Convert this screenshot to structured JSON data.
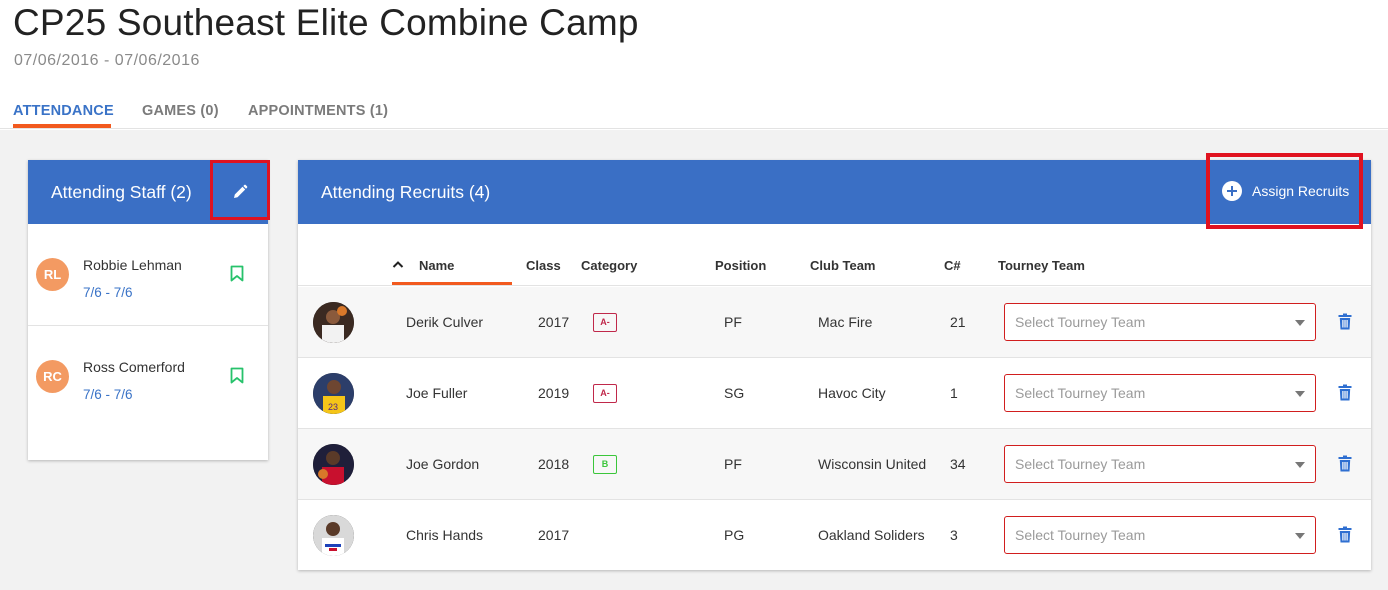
{
  "header": {
    "title": "CP25 Southeast Elite Combine Camp",
    "dates": "07/06/2016 - 07/06/2016"
  },
  "tabs": [
    {
      "label": "ATTENDANCE",
      "active": true
    },
    {
      "label": "GAMES (0)",
      "active": false
    },
    {
      "label": "APPOINTMENTS (1)",
      "active": false
    }
  ],
  "staff_panel": {
    "title": "Attending Staff (2)",
    "edit_icon": "pencil-icon",
    "members": [
      {
        "initials": "RL",
        "name": "Robbie Lehman",
        "dates": "7/6 - 7/6"
      },
      {
        "initials": "RC",
        "name": "Ross Comerford",
        "dates": "7/6 - 7/6"
      }
    ]
  },
  "recruits_panel": {
    "title": "Attending Recruits (4)",
    "assign_label": "Assign Recruits",
    "columns": [
      "Name",
      "Class",
      "Category",
      "Position",
      "Club Team",
      "C#",
      "Tourney Team"
    ],
    "sort_column": "Name",
    "select_placeholder": "Select Tourney Team",
    "rows": [
      {
        "name": "Derik Culver",
        "class": "2017",
        "category": "A-",
        "position": "PF",
        "club_team": "Mac Fire",
        "cnum": "21"
      },
      {
        "name": "Joe Fuller",
        "class": "2019",
        "category": "A-",
        "position": "SG",
        "club_team": "Havoc City",
        "cnum": "1"
      },
      {
        "name": "Joe Gordon",
        "class": "2018",
        "category": "B",
        "position": "PF",
        "club_team": "Wisconsin United",
        "cnum": "34"
      },
      {
        "name": "Chris Hands",
        "class": "2017",
        "category": "",
        "position": "PG",
        "club_team": "Oakland Soliders",
        "cnum": "3"
      }
    ]
  },
  "colors": {
    "primary": "#3a6fc5",
    "accent": "#f25a1f",
    "highlight": "#e0121f",
    "avatar": "#f39a62",
    "bookmark": "#27c26b",
    "trash": "#2f6fd1"
  }
}
